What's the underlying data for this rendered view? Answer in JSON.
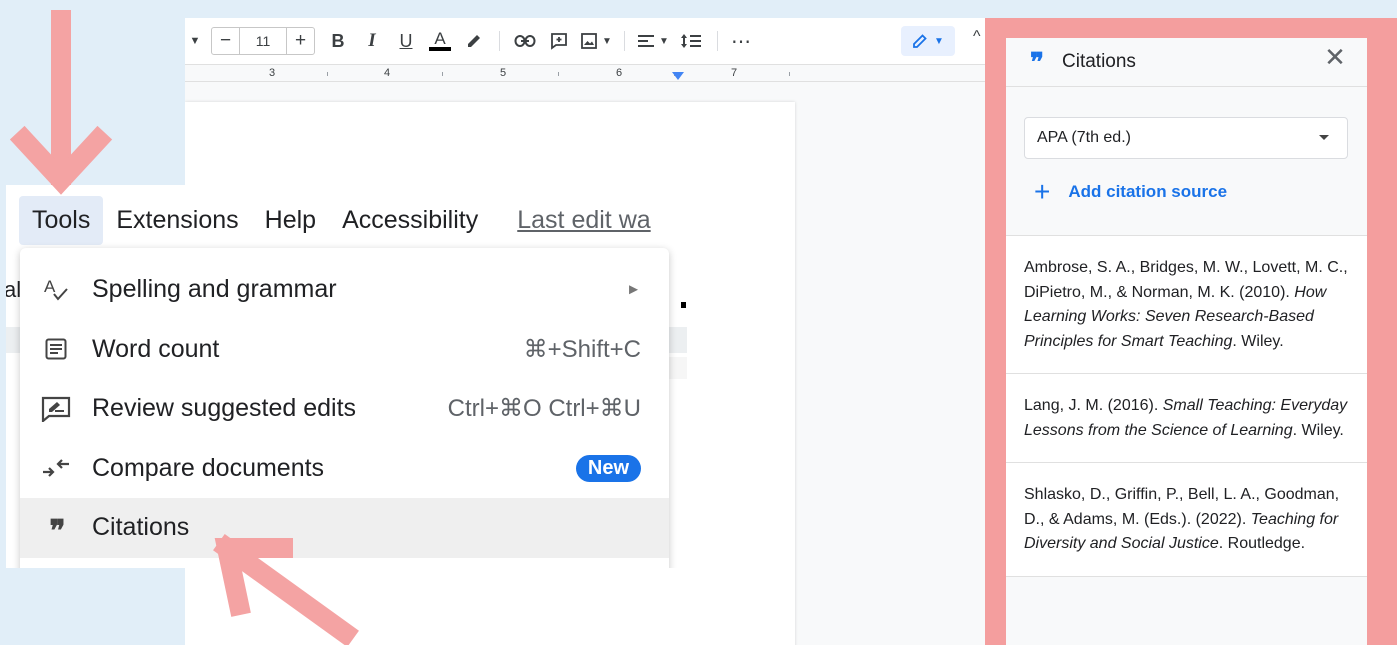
{
  "toolbar": {
    "font_size": "11",
    "minus": "−",
    "plus": "+",
    "more": "⋯"
  },
  "ruler": {
    "numbers": [
      "3",
      "4",
      "5",
      "6",
      "7"
    ]
  },
  "menubar": {
    "items": [
      "Tools",
      "Extensions",
      "Help",
      "Accessibility"
    ],
    "last_edit": "Last edit wa"
  },
  "menu_peek": {
    "text": "al"
  },
  "tools_menu": {
    "items": [
      {
        "label": "Spelling and grammar",
        "right": "►"
      },
      {
        "label": "Word count",
        "shortcut": "⌘+Shift+C"
      },
      {
        "label": "Review suggested edits",
        "shortcut": "Ctrl+⌘O Ctrl+⌘U"
      },
      {
        "label": "Compare documents",
        "badge": "New"
      },
      {
        "label": "Citations"
      }
    ]
  },
  "citations_panel": {
    "title": "Citations",
    "close": "✕",
    "style": "APA (7th ed.)",
    "add_source": "Add citation source",
    "entries": [
      {
        "before": "Ambrose, S. A., Bridges, M. W., Lovett, M. C., DiPietro, M., & Norman, M. K. (2010). ",
        "title": "How Learning Works: Seven Research-Based Principles for Smart Teaching",
        "after": ". Wiley."
      },
      {
        "before": "Lang, J. M. (2016). ",
        "title": "Small Teaching: Everyday Lessons from the Science of Learning",
        "after": ". Wiley."
      },
      {
        "before": "Shlasko, D., Griffin, P., Bell, L. A., Goodman, D., & Adams, M. (Eds.). (2022). ",
        "title": "Teaching for Diversity and Social Justice",
        "after": ". Routledge."
      }
    ]
  },
  "colors": {
    "accent": "#1a73e8",
    "frame": "#f49e9e",
    "arrow": "#f4a3a3",
    "background": "#e1eef8"
  }
}
